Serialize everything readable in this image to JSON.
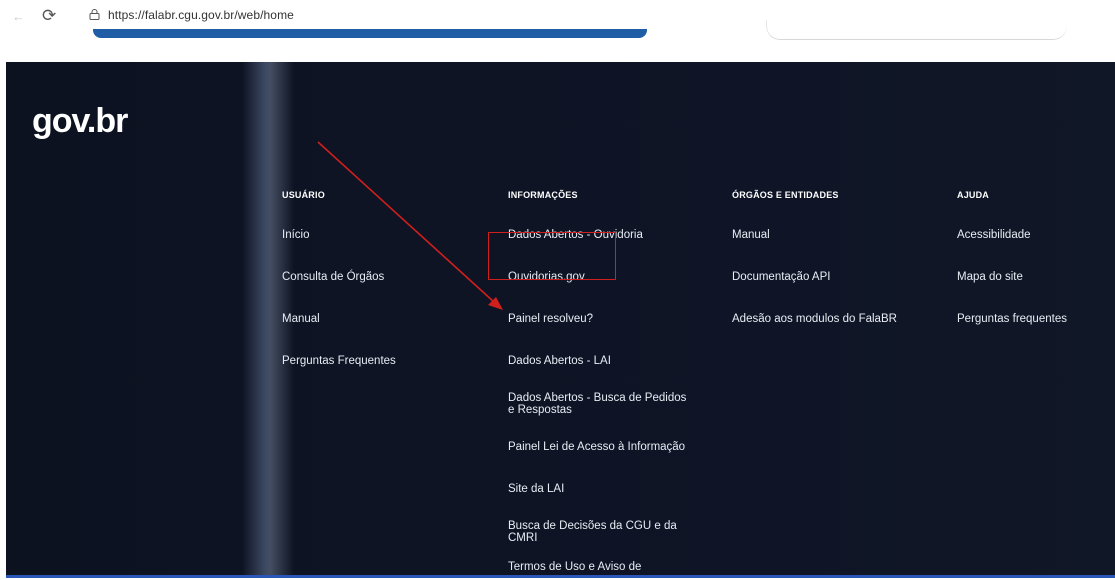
{
  "browser": {
    "back_icon": "←",
    "reload_icon": "⟳",
    "url": "https://falabr.cgu.gov.br/web/home"
  },
  "logo": {
    "text": "gov.br"
  },
  "footer": {
    "columns": [
      {
        "title": "USUÁRIO",
        "links": [
          "Início",
          "Consulta de Órgãos",
          "Manual",
          "Perguntas Frequentes"
        ]
      },
      {
        "title": "INFORMAÇÕES",
        "links": [
          "Dados Abertos - Ouvidoria",
          "Ouvidorias.gov",
          "Painel resolveu?",
          "Dados Abertos - LAI",
          "Dados Abertos - Busca de Pedidos e Respostas",
          "Painel Lei de Acesso à Informação",
          "Site da LAI",
          "Busca de Decisões da CGU e da CMRI",
          "Termos de Uso e Aviso de"
        ]
      },
      {
        "title": "ÓRGÃOS E ENTIDADES",
        "links": [
          "Manual",
          "Documentação API",
          "Adesão aos modulos do FalaBR"
        ]
      },
      {
        "title": "AJUDA",
        "links": [
          "Acessibilidade",
          "Mapa do site",
          "Perguntas frequentes"
        ]
      }
    ]
  },
  "colors": {
    "footer_bg": "#0e1424",
    "annotation": "#d0201d",
    "brand_blue": "#1f5ea6"
  }
}
